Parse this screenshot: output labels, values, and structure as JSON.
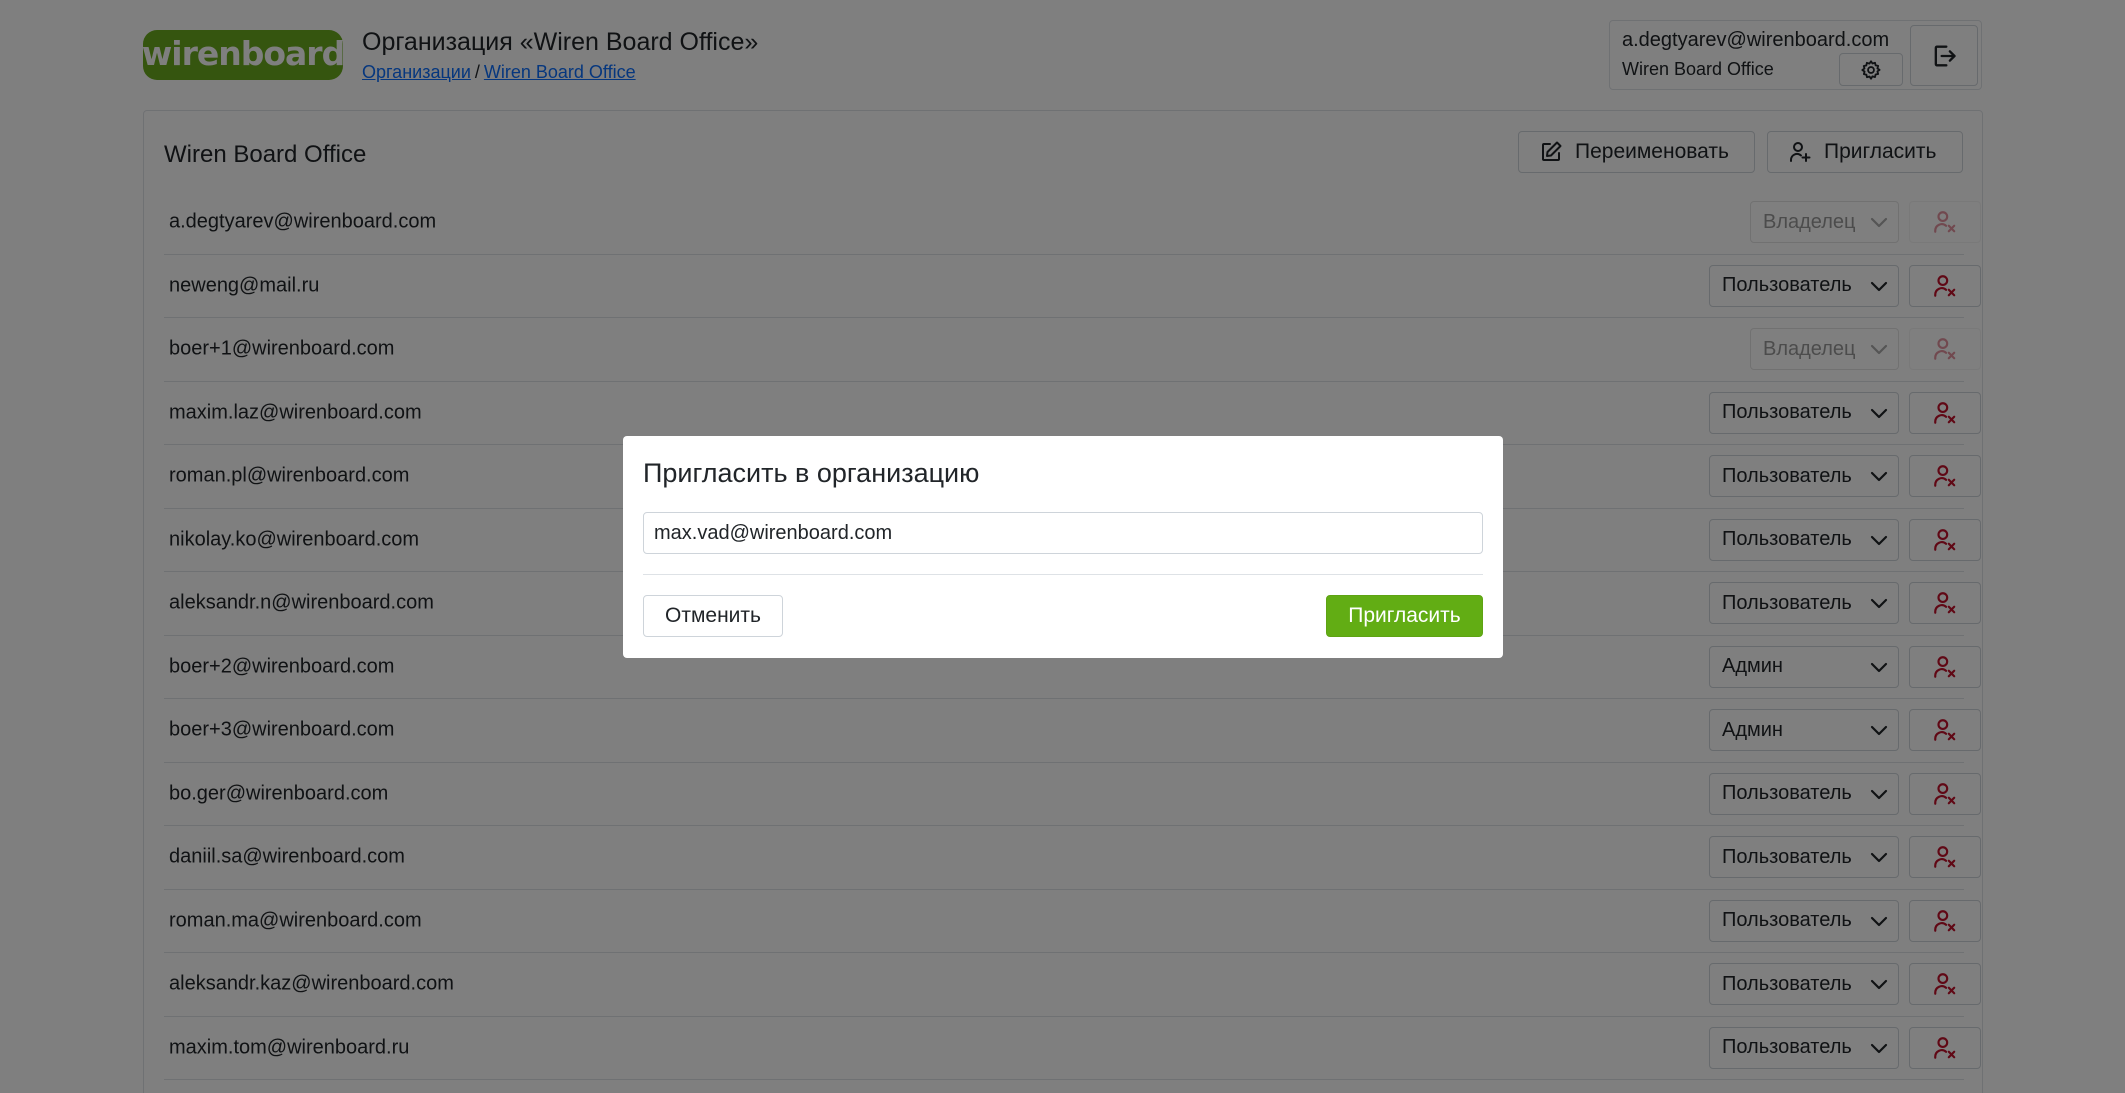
{
  "header": {
    "logo_text": "wirenboard",
    "title": "Организация «Wiren Board Office»",
    "breadcrumb": {
      "root": "Организации",
      "separator": "/",
      "current": "Wiren Board Office"
    },
    "user": {
      "email": "a.degtyarev@wirenboard.com",
      "org": "Wiren Board Office"
    }
  },
  "organization": {
    "name": "Wiren Board Office",
    "rename_label": "Переименовать",
    "invite_label": "Пригласить"
  },
  "members": [
    {
      "email": "a.degtyarev@wirenboard.com",
      "role": "Владелец",
      "disabled": true
    },
    {
      "email": "neweng@mail.ru",
      "role": "Пользователь",
      "disabled": false
    },
    {
      "email": "boer+1@wirenboard.com",
      "role": "Владелец",
      "disabled": true
    },
    {
      "email": "maxim.laz@wirenboard.com",
      "role": "Пользователь",
      "disabled": false
    },
    {
      "email": "roman.pl@wirenboard.com",
      "role": "Пользователь",
      "disabled": false
    },
    {
      "email": "nikolay.ko@wirenboard.com",
      "role": "Пользователь",
      "disabled": false
    },
    {
      "email": "aleksandr.n@wirenboard.com",
      "role": "Пользователь",
      "disabled": false
    },
    {
      "email": "boer+2@wirenboard.com",
      "role": "Админ",
      "disabled": false
    },
    {
      "email": "boer+3@wirenboard.com",
      "role": "Админ",
      "disabled": false
    },
    {
      "email": "bo.ger@wirenboard.com",
      "role": "Пользователь",
      "disabled": false
    },
    {
      "email": "daniil.sa@wirenboard.com",
      "role": "Пользователь",
      "disabled": false
    },
    {
      "email": "roman.ma@wirenboard.com",
      "role": "Пользователь",
      "disabled": false
    },
    {
      "email": "aleksandr.kaz@wirenboard.com",
      "role": "Пользователь",
      "disabled": false
    },
    {
      "email": "maxim.tom@wirenboard.ru",
      "role": "Пользователь",
      "disabled": false
    }
  ],
  "modal": {
    "title": "Пригласить в организацию",
    "input_value": "max.vad@wirenboard.com",
    "cancel_label": "Отменить",
    "submit_label": "Пригласить"
  },
  "colors": {
    "brand_green": "#6bab1e",
    "submit_green": "#62ad14",
    "remove_red": "#c0102a",
    "link_blue": "#0d6efd"
  }
}
